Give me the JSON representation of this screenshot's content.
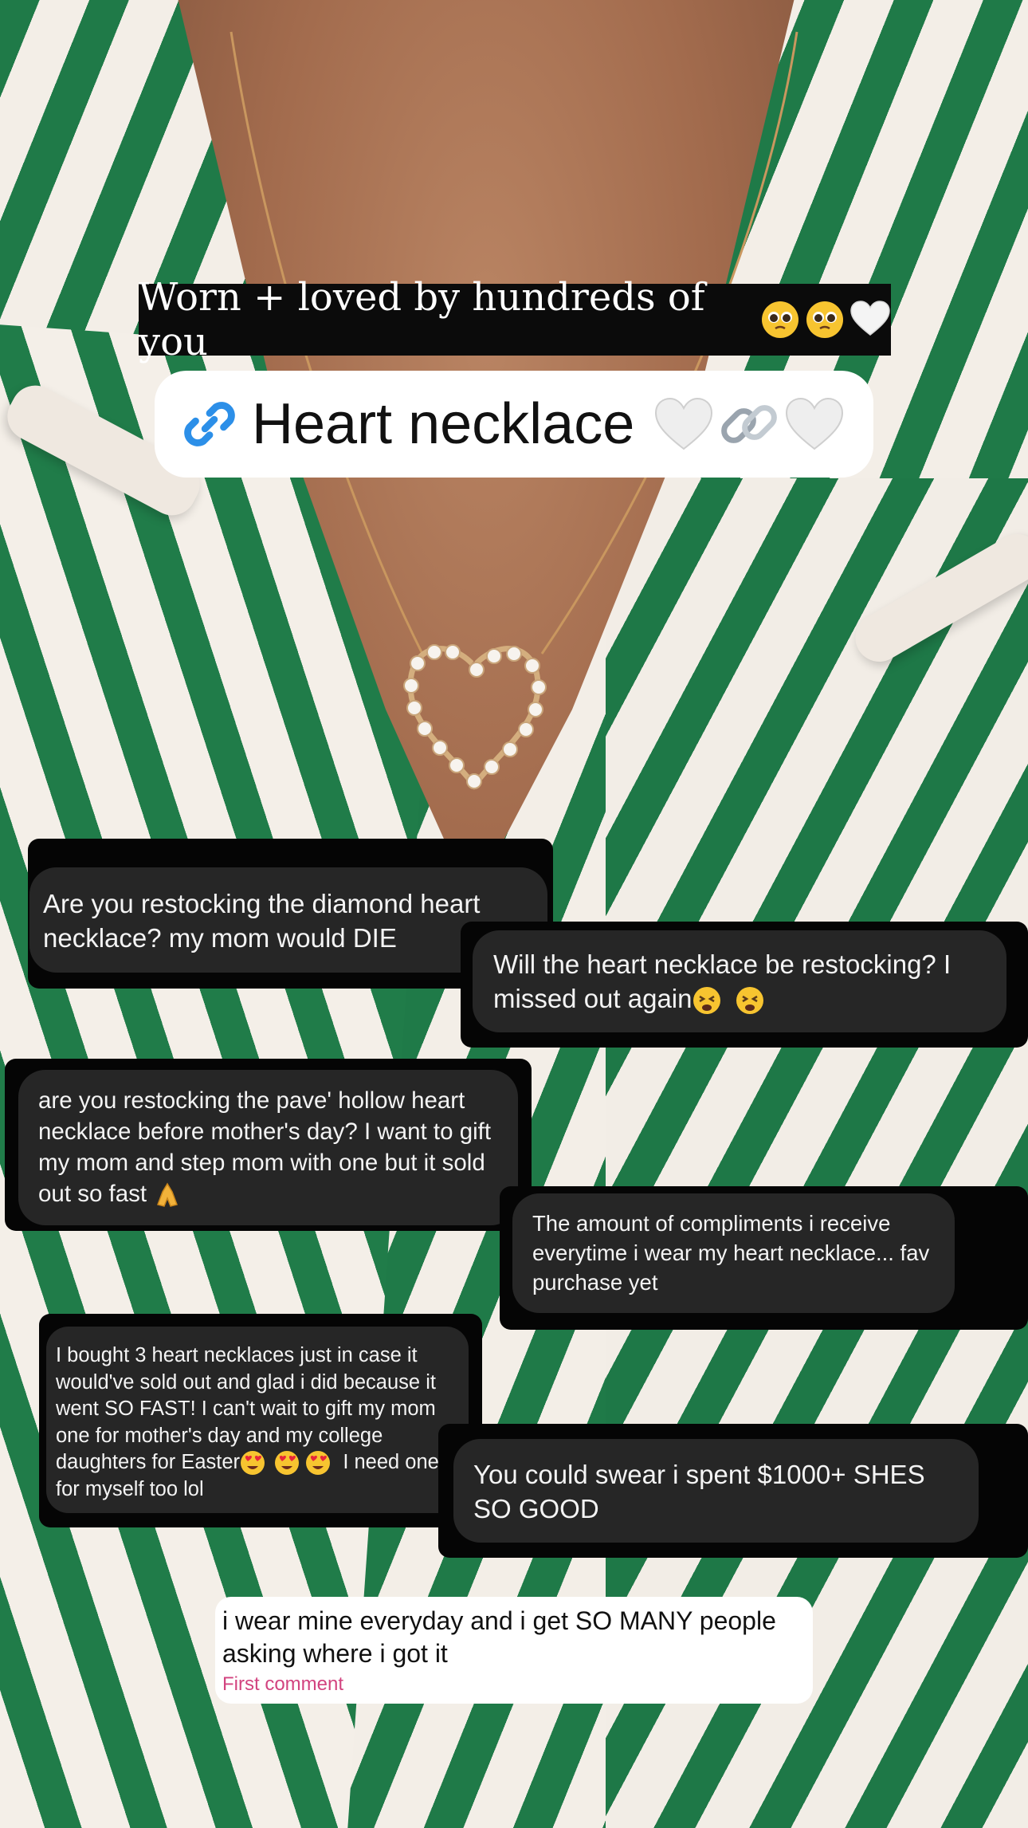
{
  "headline": {
    "text": "Worn + loved by hundreds of you",
    "emojis": [
      "pleading-face-icon",
      "pleading-face-icon",
      "white-heart-icon"
    ]
  },
  "link_sticker": {
    "label": "Heart necklace",
    "icon": "link-icon",
    "emojis": [
      "white-heart-icon",
      "chain-link-icon",
      "white-heart-icon"
    ],
    "accent": "#2c8fe8"
  },
  "messages": [
    {
      "id": "m1",
      "text": "Are you restocking the diamond heart necklace? my mom would DIE"
    },
    {
      "id": "m2",
      "text": "Will the heart necklace be restocking? I missed out again",
      "emojis": [
        "tired-face-icon",
        "tired-face-icon"
      ]
    },
    {
      "id": "m3",
      "text": "are you restocking the pave' hollow heart necklace before mother's day? I want to gift my mom and step mom with one but it sold out so fast",
      "emojis": [
        "folded-hands-icon"
      ]
    },
    {
      "id": "m4",
      "text": "The amount of compliments i receive everytime i wear my heart necklace... fav purchase yet"
    },
    {
      "id": "m5",
      "text": "I bought 3 heart necklaces just in case it would've sold out and glad i did because it went SO FAST! I can't wait to gift my mom one for mother's day and my college daughters for Easter",
      "text_after": "I need one for myself too lol",
      "emojis": [
        "heart-eyes-icon",
        "heart-eyes-icon",
        "heart-eyes-icon"
      ]
    },
    {
      "id": "m6",
      "text": "You could swear i spent $1000+ SHES SO GOOD"
    }
  ],
  "comment": {
    "text": "i wear mine everyday and i get SO MANY people asking where i got it",
    "label": "First comment",
    "label_color": "#d2437f"
  },
  "colors": {
    "stripe_green": "#1f7a48",
    "bubble": "#262626",
    "frame": "#050505"
  }
}
